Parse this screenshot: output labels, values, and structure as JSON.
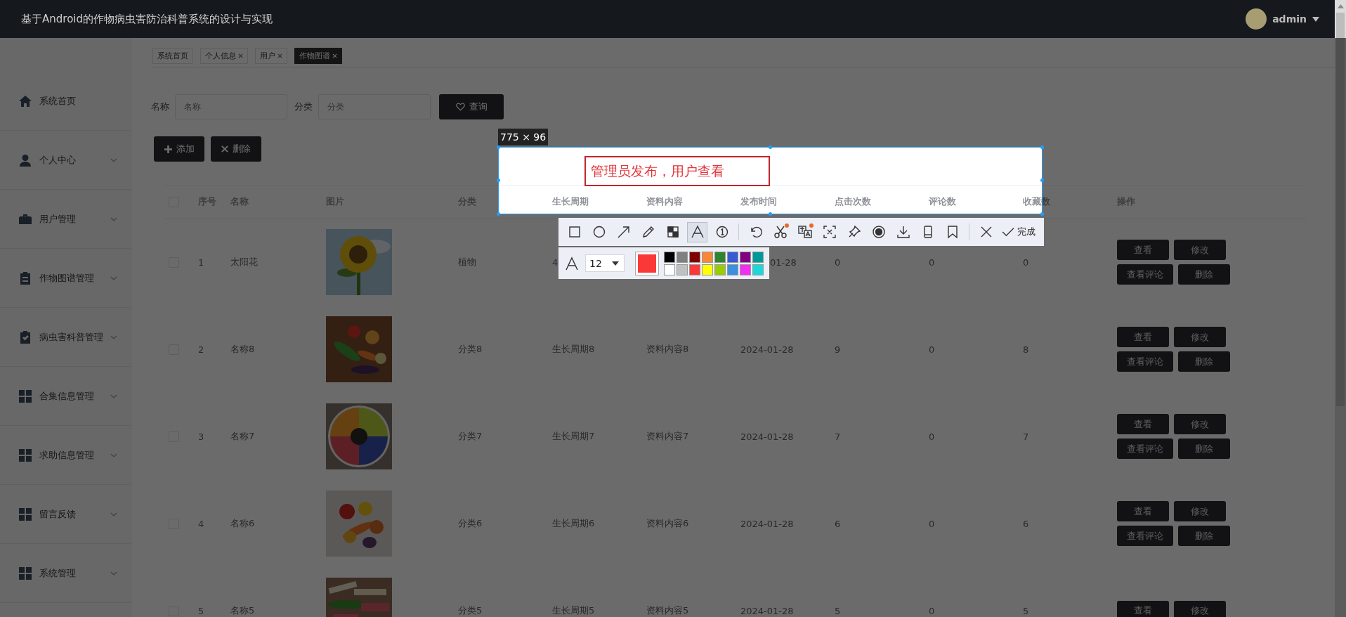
{
  "topbar": {
    "title": "基于Android的作物病虫害防治科普系统的设计与实现",
    "user": "admin"
  },
  "sidebar": {
    "items": [
      {
        "label": "系统首页",
        "kind": "link"
      },
      {
        "label": "个人中心",
        "kind": "submenu"
      },
      {
        "label": "用户管理",
        "kind": "submenu"
      },
      {
        "label": "作物图谱管理",
        "kind": "submenu"
      },
      {
        "label": "病虫害科普管理",
        "kind": "submenu"
      },
      {
        "label": "合集信息管理",
        "kind": "submenu"
      },
      {
        "label": "求助信息管理",
        "kind": "submenu"
      },
      {
        "label": "留言反馈",
        "kind": "submenu"
      },
      {
        "label": "系统管理",
        "kind": "submenu"
      }
    ]
  },
  "tabs": [
    {
      "label": "系统首页",
      "closable": false,
      "selected": false
    },
    {
      "label": "个人信息",
      "closable": true,
      "selected": false
    },
    {
      "label": "用户",
      "closable": true,
      "selected": false
    },
    {
      "label": "作物图谱",
      "closable": true,
      "selected": true
    }
  ],
  "search": {
    "fields": [
      {
        "label": "名称",
        "placeholder": "名称"
      },
      {
        "label": "分类",
        "placeholder": "分类"
      }
    ],
    "button": "查询"
  },
  "actions": [
    {
      "label": "添加",
      "kind": "add"
    },
    {
      "label": "删除",
      "kind": "delete"
    }
  ],
  "table": {
    "columns": [
      "序号",
      "名称",
      "图片",
      "分类",
      "生长周期",
      "资料内容",
      "发布时间",
      "点击次数",
      "评论数",
      "收藏数",
      "操作"
    ],
    "header_checked": false,
    "rows": [
      {
        "checked": false,
        "cells": [
          "1",
          "太阳花",
          {
            "kind": "picture"
          },
          "植物",
          "4",
          "",
          {
            "kind": "clipped",
            "text": "01-28"
          },
          "0",
          "0",
          "0"
        ],
        "buttons": [
          "查看",
          "修改",
          "查看评论",
          "删除"
        ]
      },
      {
        "checked": false,
        "cells": [
          "2",
          "名称8",
          {
            "kind": "picture"
          },
          "分类8",
          "生长周期8",
          "资料内容8",
          "2024-01-28",
          "9",
          "0",
          "8"
        ],
        "buttons": [
          "查看",
          "修改",
          "查看评论",
          "删除"
        ]
      },
      {
        "checked": false,
        "cells": [
          "3",
          "名称7",
          {
            "kind": "picture"
          },
          "分类7",
          "生长周期7",
          "资料内容7",
          "2024-01-28",
          "7",
          "0",
          "7"
        ],
        "buttons": [
          "查看",
          "修改",
          "查看评论",
          "删除"
        ]
      },
      {
        "checked": false,
        "cells": [
          "4",
          "名称6",
          {
            "kind": "picture"
          },
          "分类6",
          "生长周期6",
          "资料内容6",
          "2024-01-28",
          "6",
          "0",
          "6"
        ],
        "buttons": [
          "查看",
          "修改",
          "查看评论",
          "删除"
        ]
      },
      {
        "checked": false,
        "cells": [
          "5",
          "名称5",
          {
            "kind": "picture"
          },
          "分类5",
          "生长周期5",
          "资料内容5",
          "2024-01-28",
          "5",
          "0",
          "5"
        ],
        "buttons": [
          "查看",
          "修改"
        ]
      }
    ]
  },
  "capture": {
    "size": "775 × 96",
    "annotation": "管理员发布，用户查看",
    "tool_groups": [
      [
        {
          "kind": "rectangle",
          "selected": false,
          "badge": false
        },
        {
          "kind": "ellipse",
          "selected": false,
          "badge": false
        },
        {
          "kind": "arrow",
          "selected": false,
          "badge": false
        },
        {
          "kind": "pencil",
          "selected": false,
          "badge": false
        },
        {
          "kind": "mosaic",
          "selected": false,
          "badge": false
        },
        {
          "kind": "text",
          "selected": true,
          "badge": false
        },
        {
          "kind": "number",
          "selected": false,
          "badge": false
        }
      ],
      [
        {
          "kind": "undo",
          "selected": false,
          "badge": false
        },
        {
          "kind": "cut",
          "selected": false,
          "badge": true
        },
        {
          "kind": "translate",
          "selected": false,
          "badge": true
        },
        {
          "kind": "ocr",
          "selected": false,
          "badge": false
        },
        {
          "kind": "pin",
          "selected": false,
          "badge": false
        },
        {
          "kind": "record",
          "selected": false,
          "badge": false
        },
        {
          "kind": "download",
          "selected": false,
          "badge": false
        },
        {
          "kind": "phone",
          "selected": false,
          "badge": false
        },
        {
          "kind": "bookmark",
          "selected": false,
          "badge": false
        }
      ],
      [
        {
          "kind": "close",
          "selected": false,
          "badge": false
        }
      ]
    ],
    "done": "完成",
    "font_size": "12",
    "current": {
      "color": "#fb3838"
    },
    "palette": [
      {
        "color": "#000000"
      },
      {
        "color": "#808080"
      },
      {
        "color": "#800000"
      },
      {
        "color": "#f7883a"
      },
      {
        "color": "#308430"
      },
      {
        "color": "#385ad3"
      },
      {
        "color": "#800080"
      },
      {
        "color": "#009999"
      },
      {
        "color": "#ffffff"
      },
      {
        "color": "#c0c0c0"
      },
      {
        "color": "#fb3838"
      },
      {
        "color": "#ffff00"
      },
      {
        "color": "#99cc00"
      },
      {
        "color": "#3d8fdf"
      },
      {
        "color": "#f030f0"
      },
      {
        "color": "#1ad9d9"
      }
    ]
  }
}
